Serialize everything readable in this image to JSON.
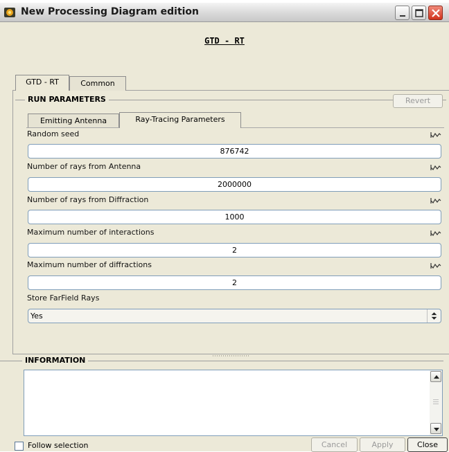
{
  "window": {
    "title": "New Processing Diagram edition",
    "header_title": "GTD - RT"
  },
  "outer_tabs": [
    {
      "label": "GTD - RT",
      "active": true
    },
    {
      "label": "Common",
      "active": false
    }
  ],
  "run_parameters": {
    "title": "RUN PARAMETERS",
    "revert_label": "Revert",
    "inner_tabs": [
      {
        "label": "Emitting Antenna",
        "active": false
      },
      {
        "label": "Ray-Tracing Parameters",
        "active": true
      }
    ],
    "fields": [
      {
        "label": "Random seed",
        "value": "876742"
      },
      {
        "label": "Number of rays from Antenna",
        "value": "2000000"
      },
      {
        "label": "Number of rays from Diffraction",
        "value": "1000"
      },
      {
        "label": "Maximum number of interactions",
        "value": "2"
      },
      {
        "label": "Maximum number of diffractions",
        "value": "2"
      }
    ],
    "store_farfield": {
      "label": "Store FarField Rays",
      "value": "Yes"
    }
  },
  "information": {
    "title": "INFORMATION",
    "text": ""
  },
  "footer": {
    "follow_selection_label": "Follow selection",
    "follow_selection_checked": false,
    "cancel_label": "Cancel",
    "apply_label": "Apply",
    "close_label": "Close"
  },
  "icons": {
    "app": "processing-app-icon",
    "field_action": "waveform-icon",
    "select": "updown-arrows-icon"
  },
  "colors": {
    "window_bg": "#ece9d8",
    "input_border": "#7f9db9",
    "close_button": "#d2321c"
  }
}
